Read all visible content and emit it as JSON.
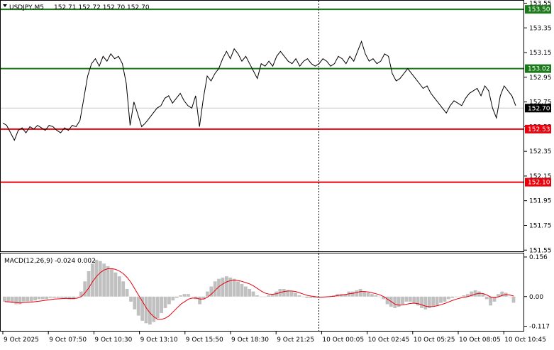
{
  "header": {
    "symbol": "USDJPY,M5",
    "ohlc": "152.71 152.72 152.70 152.70"
  },
  "indicator": {
    "label": "MACD(12,26,9) -0.024 0.002"
  },
  "colors": {
    "price_line": "#000000",
    "support_line": "#e8000b",
    "resistance_line": "#1a7a1a",
    "current_price_box": "#000000",
    "macd_hist": "#c0c0c0",
    "macd_signal": "#e8000b",
    "grid": "#cfd6dc"
  },
  "chart_data": [
    {
      "type": "line",
      "title": "USDJPY,M5",
      "y_ticks": [
        "153.55",
        "153.35",
        "153.15",
        "152.95",
        "152.75",
        "152.55",
        "152.35",
        "152.15",
        "151.95",
        "151.75",
        "151.55"
      ],
      "ylim": [
        151.5,
        153.6
      ],
      "x_ticks": [
        "9 Oct 2025",
        "9 Oct 07:50",
        "9 Oct 10:30",
        "9 Oct 13:10",
        "9 Oct 15:50",
        "9 Oct 18:30",
        "9 Oct 21:25",
        "10 Oct 00:05",
        "10 Oct 02:45",
        "10 Oct 05:25",
        "10 Oct 08:05",
        "10 Oct 10:45"
      ],
      "levels": [
        {
          "value": 153.5,
          "label": "153.50",
          "kind": "resistance"
        },
        {
          "value": 153.02,
          "label": "153.02",
          "kind": "resistance"
        },
        {
          "value": 152.53,
          "label": "152.53",
          "kind": "support"
        },
        {
          "value": 152.1,
          "label": "152.10",
          "kind": "support"
        }
      ],
      "current_price": {
        "value": 152.7,
        "label": "152.70"
      },
      "series": [
        {
          "values": [
            152.58,
            152.56,
            152.5,
            152.44,
            152.52,
            152.54,
            152.5,
            152.55,
            152.53,
            152.56,
            152.54,
            152.52,
            152.56,
            152.55,
            152.52,
            152.5,
            152.54,
            152.52,
            152.56,
            152.55,
            152.6,
            152.78,
            152.96,
            153.06,
            153.1,
            153.04,
            153.12,
            153.08,
            153.14,
            153.1,
            153.12,
            153.06,
            152.9,
            152.56,
            152.75,
            152.65,
            152.55,
            152.58,
            152.62,
            152.66,
            152.7,
            152.72,
            152.78,
            152.8,
            152.74,
            152.78,
            152.82,
            152.76,
            152.72,
            152.7,
            152.8,
            152.55,
            152.78,
            152.96,
            152.92,
            152.98,
            153.02,
            153.1,
            153.16,
            153.1,
            153.18,
            153.14,
            153.08,
            153.12,
            153.06,
            153.0,
            152.94,
            153.06,
            153.04,
            153.08,
            153.04,
            153.12,
            153.16,
            153.12,
            153.08,
            153.06,
            153.1,
            153.04,
            153.08,
            153.1,
            153.06,
            153.04,
            153.06,
            153.1,
            153.08,
            153.04,
            153.06,
            153.12,
            153.1,
            153.06,
            153.12,
            153.08,
            153.16,
            153.24,
            153.14,
            153.08,
            153.1,
            153.06,
            153.08,
            153.14,
            153.12,
            152.98,
            152.92,
            152.94,
            152.98,
            153.02,
            152.98,
            152.94,
            152.9,
            152.86,
            152.88,
            152.82,
            152.78,
            152.74,
            152.7,
            152.66,
            152.72,
            152.76,
            152.74,
            152.72,
            152.78,
            152.82,
            152.84,
            152.86,
            152.8,
            152.88,
            152.84,
            152.7,
            152.62,
            152.8,
            152.88,
            152.84,
            152.8,
            152.72
          ]
        }
      ]
    },
    {
      "type": "bar",
      "title": "MACD(12,26,9)",
      "y_ticks": [
        "0.156",
        "0.00",
        "-0.117"
      ],
      "ylim": [
        -0.135,
        0.17
      ],
      "macd_value": -0.024,
      "signal_value": 0.002,
      "histogram": [
        -0.02,
        -0.02,
        -0.025,
        -0.03,
        -0.03,
        -0.02,
        -0.02,
        -0.02,
        -0.015,
        -0.01,
        -0.01,
        -0.01,
        -0.005,
        -0.005,
        -0.005,
        -0.005,
        -0.005,
        -0.01,
        -0.01,
        0.0,
        0.02,
        0.06,
        0.1,
        0.13,
        0.145,
        0.14,
        0.13,
        0.12,
        0.11,
        0.095,
        0.08,
        0.06,
        0.03,
        -0.02,
        -0.05,
        -0.075,
        -0.095,
        -0.105,
        -0.11,
        -0.1,
        -0.085,
        -0.065,
        -0.045,
        -0.03,
        -0.015,
        -0.005,
        0.005,
        0.01,
        0.01,
        0.0,
        -0.01,
        -0.03,
        -0.01,
        0.02,
        0.04,
        0.06,
        0.07,
        0.075,
        0.08,
        0.075,
        0.07,
        0.06,
        0.05,
        0.04,
        0.03,
        0.02,
        0.005,
        0.0,
        0.0,
        0.005,
        0.01,
        0.02,
        0.03,
        0.03,
        0.025,
        0.02,
        0.015,
        0.005,
        0.0,
        -0.005,
        -0.005,
        -0.005,
        -0.005,
        0.0,
        0.0,
        0.0,
        0.005,
        0.01,
        0.01,
        0.01,
        0.02,
        0.02,
        0.025,
        0.03,
        0.02,
        0.015,
        0.01,
        0.005,
        0.0,
        -0.01,
        -0.03,
        -0.04,
        -0.045,
        -0.04,
        -0.03,
        -0.02,
        -0.02,
        -0.025,
        -0.035,
        -0.045,
        -0.05,
        -0.045,
        -0.04,
        -0.035,
        -0.025,
        -0.02,
        -0.01,
        -0.005,
        0.0,
        0.0,
        0.005,
        0.01,
        0.02,
        0.025,
        0.02,
        0.01,
        -0.01,
        -0.035,
        -0.02,
        0.01,
        0.02,
        0.015,
        0.0,
        -0.024
      ],
      "signal": [
        -0.02,
        -0.021,
        -0.022,
        -0.024,
        -0.025,
        -0.024,
        -0.023,
        -0.022,
        -0.02,
        -0.018,
        -0.016,
        -0.014,
        -0.012,
        -0.01,
        -0.009,
        -0.008,
        -0.007,
        -0.008,
        -0.008,
        -0.006,
        0.0,
        0.015,
        0.035,
        0.06,
        0.08,
        0.095,
        0.105,
        0.11,
        0.11,
        0.107,
        0.1,
        0.09,
        0.075,
        0.055,
        0.03,
        0.005,
        -0.02,
        -0.045,
        -0.065,
        -0.08,
        -0.09,
        -0.09,
        -0.085,
        -0.075,
        -0.06,
        -0.045,
        -0.03,
        -0.02,
        -0.01,
        -0.006,
        -0.006,
        -0.01,
        -0.01,
        -0.002,
        0.01,
        0.025,
        0.04,
        0.05,
        0.058,
        0.063,
        0.065,
        0.063,
        0.06,
        0.055,
        0.05,
        0.042,
        0.032,
        0.022,
        0.014,
        0.01,
        0.009,
        0.011,
        0.016,
        0.02,
        0.022,
        0.022,
        0.02,
        0.015,
        0.01,
        0.005,
        0.002,
        0.0,
        -0.002,
        -0.002,
        -0.001,
        0.0,
        0.001,
        0.004,
        0.006,
        0.008,
        0.011,
        0.013,
        0.016,
        0.02,
        0.02,
        0.018,
        0.015,
        0.011,
        0.007,
        0.0,
        -0.01,
        -0.02,
        -0.03,
        -0.034,
        -0.033,
        -0.03,
        -0.027,
        -0.026,
        -0.028,
        -0.033,
        -0.038,
        -0.04,
        -0.039,
        -0.036,
        -0.032,
        -0.027,
        -0.021,
        -0.015,
        -0.01,
        -0.006,
        -0.003,
        0.0,
        0.005,
        0.01,
        0.013,
        0.012,
        0.006,
        -0.002,
        -0.005,
        -0.001,
        0.005,
        0.008,
        0.006,
        0.002
      ]
    }
  ]
}
